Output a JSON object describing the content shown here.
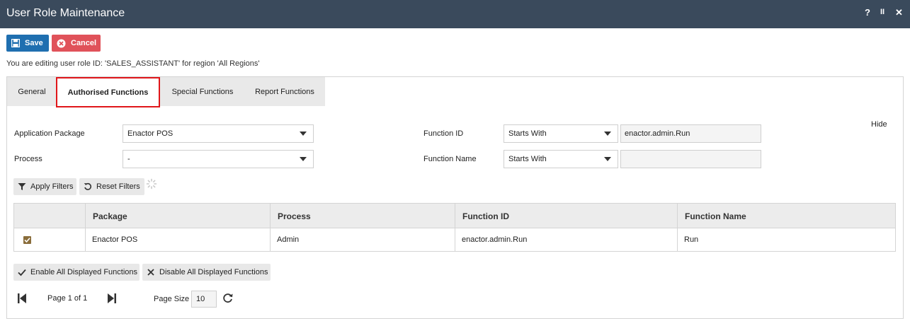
{
  "window": {
    "title": "User Role Maintenance",
    "help": "?",
    "pause": "II",
    "close": "✕"
  },
  "toolbar": {
    "save_label": "Save",
    "cancel_label": "Cancel"
  },
  "editing_message": "You are editing user role ID: 'SALES_ASSISTANT' for region 'All Regions'",
  "tabs": [
    {
      "label": "General"
    },
    {
      "label": "Authorised Functions"
    },
    {
      "label": "Special Functions"
    },
    {
      "label": "Report Functions"
    }
  ],
  "active_tab": "Authorised Functions",
  "filters": {
    "hide_label": "Hide",
    "application_package": {
      "label": "Application Package",
      "value": "Enactor POS"
    },
    "process": {
      "label": "Process",
      "value": "-"
    },
    "function_id": {
      "label": "Function ID",
      "operator": "Starts With",
      "value": "enactor.admin.Run"
    },
    "function_name": {
      "label": "Function Name",
      "operator": "Starts With",
      "value": ""
    },
    "apply_label": "Apply Filters",
    "reset_label": "Reset Filters"
  },
  "table": {
    "columns": [
      "Package",
      "Process",
      "Function ID",
      "Function Name"
    ],
    "rows": [
      {
        "checked": true,
        "package": "Enactor POS",
        "process": "Admin",
        "function_id": "enactor.admin.Run",
        "function_name": "Run"
      }
    ]
  },
  "actions": {
    "enable_all_label": "Enable All Displayed Functions",
    "disable_all_label": "Disable All Displayed Functions"
  },
  "pager": {
    "page_text": "Page 1 of 1",
    "page_size_label": "Page Size",
    "page_size": "10"
  },
  "colors": {
    "titlebar": "#3a4a5c",
    "save": "#1f6fb0",
    "cancel": "#e0525a",
    "active_tab_border": "#e0161a",
    "checkbox": "#8a6d3b"
  }
}
